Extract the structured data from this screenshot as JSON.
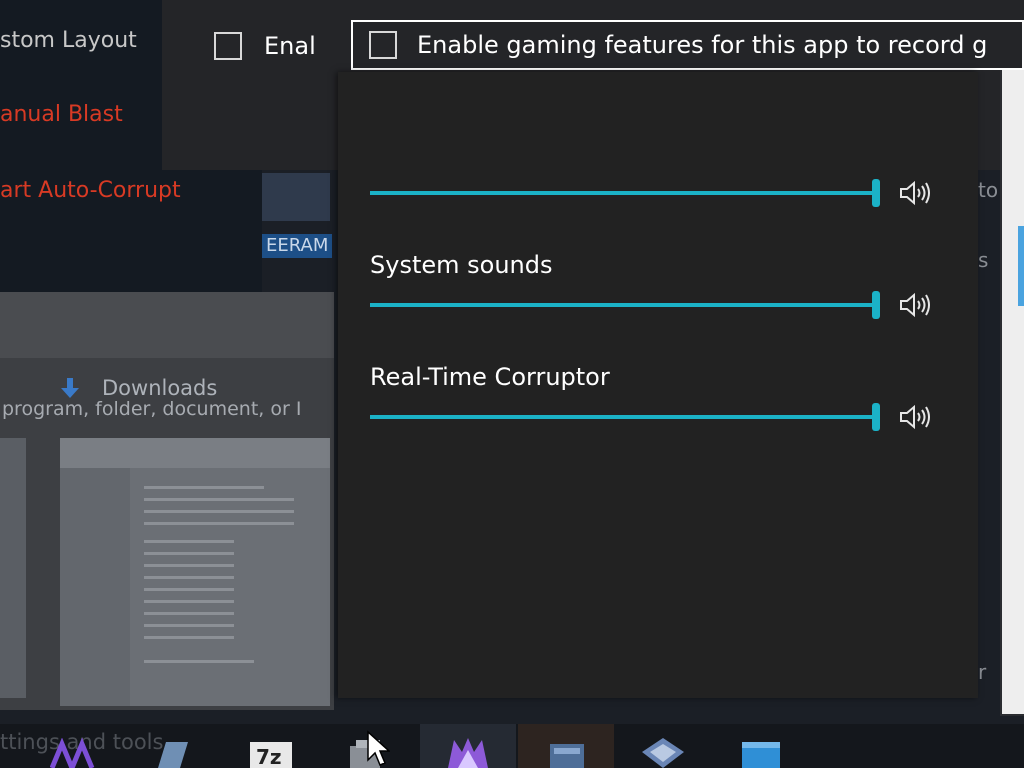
{
  "background": {
    "menu_items": [
      {
        "label": "stom Layout",
        "color": "#c8c8c8"
      },
      {
        "label": "anual Blast",
        "color": "#d83a24"
      },
      {
        "label": "art Auto-Corrupt",
        "color": "#d83a24"
      }
    ],
    "badge_text": "EERAM",
    "downloads_label": "Downloads",
    "window_text": "program, folder, document, or I",
    "right_text_1": "to",
    "right_text_2": "s",
    "right_text_3": "r",
    "taskbar_text": "ttings and tools"
  },
  "gamebar": {
    "checkbox_left_label": "Enal",
    "checkbox_focused_label": "Enable gaming features for this app to record g",
    "checkbox_left_checked": false,
    "checkbox_focused_checked": false
  },
  "volume": {
    "accent_color": "#1bb2c7",
    "rows": [
      {
        "label": "",
        "level": 1.0,
        "icon": "speaker-icon"
      },
      {
        "label": "System sounds",
        "level": 1.0,
        "icon": "speaker-icon"
      },
      {
        "label": "Real-Time Corruptor",
        "level": 1.0,
        "icon": "speaker-icon"
      }
    ]
  },
  "taskbar": {
    "icons": [
      "app-icon-purple",
      "app-icon-blue",
      "7zip-icon",
      "file-icon",
      "game-icon",
      "app-icon-orange",
      "app-icon-network",
      "app-icon-blue-window"
    ]
  }
}
